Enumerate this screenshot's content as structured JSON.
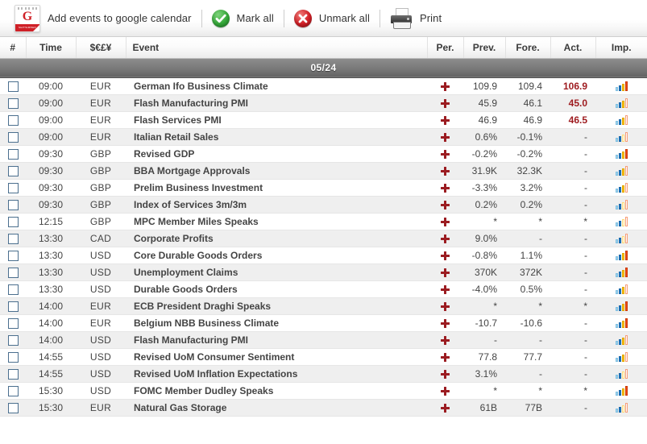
{
  "toolbar": {
    "gcal_icon": "google-calendar-icon",
    "gcal_letter": "G",
    "gcal_band_text": "SEPTEMBER",
    "add_to_google_calendar": "Add events to google calendar",
    "mark_all": "Mark all",
    "unmark_all": "Unmark all",
    "print": "Print"
  },
  "table": {
    "headers": {
      "number": "#",
      "time": "Time",
      "currency": "$€£¥",
      "event": "Event",
      "per": "Per.",
      "prev": "Prev.",
      "fore": "Fore.",
      "act": "Act.",
      "imp": "Imp."
    },
    "date_separator": "05/24",
    "rows": [
      {
        "time": "09:00",
        "currency": "EUR",
        "event": "German Ifo Business Climate",
        "prev": "109.9",
        "fore": "109.4",
        "act": "106.9",
        "act_highlight": true,
        "impact": 4
      },
      {
        "time": "09:00",
        "currency": "EUR",
        "event": "Flash Manufacturing PMI",
        "prev": "45.9",
        "fore": "46.1",
        "act": "45.0",
        "act_highlight": true,
        "impact": 3
      },
      {
        "time": "09:00",
        "currency": "EUR",
        "event": "Flash Services PMI",
        "prev": "46.9",
        "fore": "46.9",
        "act": "46.5",
        "act_highlight": true,
        "impact": 3
      },
      {
        "time": "09:00",
        "currency": "EUR",
        "event": "Italian Retail Sales",
        "prev": "0.6%",
        "fore": "-0.1%",
        "act": "-",
        "act_highlight": false,
        "impact": 2
      },
      {
        "time": "09:30",
        "currency": "GBP",
        "event": "Revised GDP",
        "prev": "-0.2%",
        "fore": "-0.2%",
        "act": "-",
        "act_highlight": false,
        "impact": 4
      },
      {
        "time": "09:30",
        "currency": "GBP",
        "event": "BBA Mortgage Approvals",
        "prev": "31.9K",
        "fore": "32.3K",
        "act": "-",
        "act_highlight": false,
        "impact": 3
      },
      {
        "time": "09:30",
        "currency": "GBP",
        "event": "Prelim Business Investment",
        "prev": "-3.3%",
        "fore": "3.2%",
        "act": "-",
        "act_highlight": false,
        "impact": 3
      },
      {
        "time": "09:30",
        "currency": "GBP",
        "event": "Index of Services 3m/3m",
        "prev": "0.2%",
        "fore": "0.2%",
        "act": "-",
        "act_highlight": false,
        "impact": 2
      },
      {
        "time": "12:15",
        "currency": "GBP",
        "event": "MPC Member Miles Speaks",
        "prev": "*",
        "fore": "*",
        "act": "*",
        "act_highlight": false,
        "impact": 2
      },
      {
        "time": "13:30",
        "currency": "CAD",
        "event": "Corporate Profits",
        "prev": "9.0%",
        "fore": "-",
        "act": "-",
        "act_highlight": false,
        "impact": 2
      },
      {
        "time": "13:30",
        "currency": "USD",
        "event": "Core Durable Goods Orders",
        "prev": "-0.8%",
        "fore": "1.1%",
        "act": "-",
        "act_highlight": false,
        "impact": 4
      },
      {
        "time": "13:30",
        "currency": "USD",
        "event": "Unemployment Claims",
        "prev": "370K",
        "fore": "372K",
        "act": "-",
        "act_highlight": false,
        "impact": 4
      },
      {
        "time": "13:30",
        "currency": "USD",
        "event": "Durable Goods Orders",
        "prev": "-4.0%",
        "fore": "0.5%",
        "act": "-",
        "act_highlight": false,
        "impact": 3
      },
      {
        "time": "14:00",
        "currency": "EUR",
        "event": "ECB President Draghi Speaks",
        "prev": "*",
        "fore": "*",
        "act": "*",
        "act_highlight": false,
        "impact": 4
      },
      {
        "time": "14:00",
        "currency": "EUR",
        "event": "Belgium NBB Business Climate",
        "prev": "-10.7",
        "fore": "-10.6",
        "act": "-",
        "act_highlight": false,
        "impact": 4
      },
      {
        "time": "14:00",
        "currency": "USD",
        "event": "Flash Manufacturing PMI",
        "prev": "-",
        "fore": "-",
        "act": "-",
        "act_highlight": false,
        "impact": 3
      },
      {
        "time": "14:55",
        "currency": "USD",
        "event": "Revised UoM Consumer Sentiment",
        "prev": "77.8",
        "fore": "77.7",
        "act": "-",
        "act_highlight": false,
        "impact": 3
      },
      {
        "time": "14:55",
        "currency": "USD",
        "event": "Revised UoM Inflation Expectations",
        "prev": "3.1%",
        "fore": "-",
        "act": "-",
        "act_highlight": false,
        "impact": 2
      },
      {
        "time": "15:30",
        "currency": "USD",
        "event": "FOMC Member Dudley Speaks",
        "prev": "*",
        "fore": "*",
        "act": "*",
        "act_highlight": false,
        "impact": 4
      },
      {
        "time": "15:30",
        "currency": "EUR",
        "event": "Natural Gas Storage",
        "prev": "61B",
        "fore": "77B",
        "act": "-",
        "act_highlight": false,
        "impact": 2
      }
    ]
  },
  "colors": {
    "accent_red": "#9b1c21",
    "highlight_red": "#9e1b1f",
    "date_bar": "#7b7b7b",
    "row_alt": "#efefef",
    "impact_low": "#9fd3ef",
    "impact_mid": "#1f78c8",
    "impact_high": "#ffc20e",
    "impact_top": "#f24a0c"
  }
}
